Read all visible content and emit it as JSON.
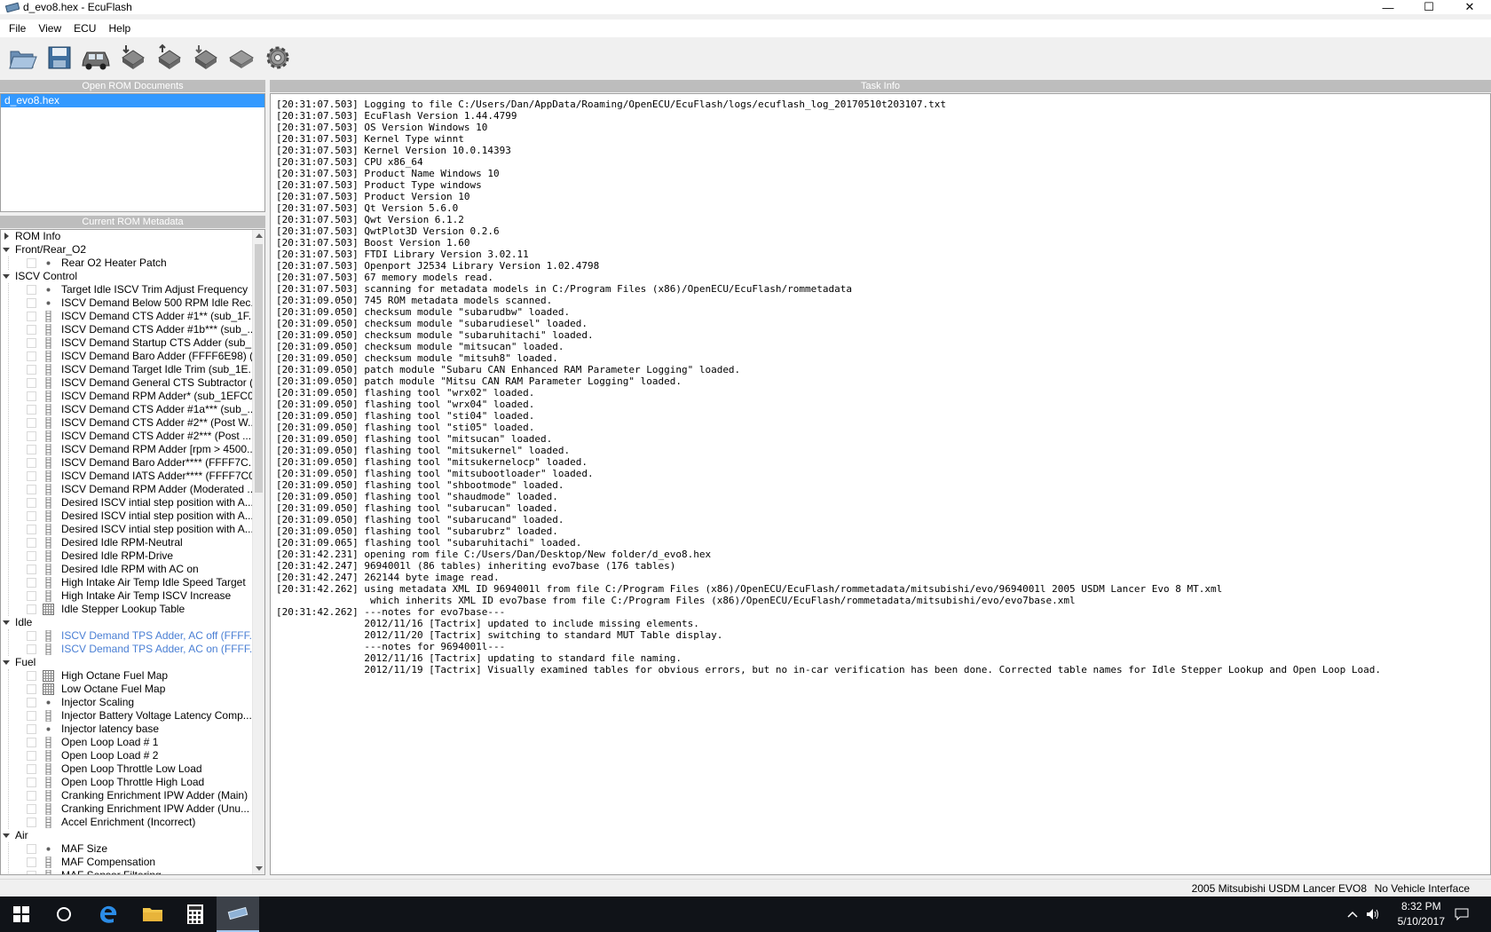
{
  "window": {
    "title": "d_evo8.hex - EcuFlash",
    "minimize": "—",
    "maximize": "☐",
    "close": "✕"
  },
  "menu": [
    "File",
    "View",
    "ECU",
    "Help"
  ],
  "toolbar": {
    "buttons": [
      "open-icon",
      "save-icon",
      "car-icon",
      "read-rom-icon",
      "write-rom-icon",
      "test-write-icon",
      "chip-icon",
      "settings-gear-icon"
    ]
  },
  "open_rom": {
    "header": "Open ROM Documents",
    "items": [
      "d_evo8.hex"
    ]
  },
  "metadata": {
    "header": "Current ROM Metadata",
    "categories": [
      {
        "label": "ROM Info",
        "expanded": false,
        "items": []
      },
      {
        "label": "Front/Rear_O2",
        "expanded": true,
        "items": [
          {
            "label": "Rear O2 Heater Patch",
            "icon": "scalar-icon"
          }
        ]
      },
      {
        "label": "ISCV Control",
        "expanded": true,
        "items": [
          {
            "label": "Target Idle ISCV Trim Adjust Frequency",
            "icon": "scalar-icon"
          },
          {
            "label": "ISCV Demand Below 500 RPM Idle Rec...",
            "icon": "scalar-icon"
          },
          {
            "label": "ISCV Demand CTS Adder #1** (sub_1F...",
            "icon": "axis-icon"
          },
          {
            "label": "ISCV Demand CTS Adder #1b*** (sub_...",
            "icon": "axis-icon"
          },
          {
            "label": "ISCV Demand Startup CTS Adder (sub_...",
            "icon": "axis-icon"
          },
          {
            "label": "ISCV Demand Baro Adder (FFFF6E98) (...",
            "icon": "axis-icon"
          },
          {
            "label": "ISCV Demand Target Idle Trim (sub_1E...",
            "icon": "axis-icon"
          },
          {
            "label": "ISCV Demand General CTS Subtractor (...",
            "icon": "axis-icon"
          },
          {
            "label": "ISCV Demand RPM Adder* (sub_1EFC0)",
            "icon": "axis-icon"
          },
          {
            "label": "ISCV Demand CTS Adder #1a*** (sub_...",
            "icon": "axis-icon"
          },
          {
            "label": "ISCV Demand CTS Adder #2** (Post W...",
            "icon": "axis-icon"
          },
          {
            "label": "ISCV Demand CTS Adder #2*** (Post ...",
            "icon": "axis-icon"
          },
          {
            "label": "ISCV Demand RPM Adder [rpm > 4500...",
            "icon": "axis-icon"
          },
          {
            "label": "ISCV Demand Baro Adder**** (FFFF7C...",
            "icon": "axis-icon"
          },
          {
            "label": "ISCV Demand IATS Adder**** (FFFF7C0...",
            "icon": "axis-icon"
          },
          {
            "label": "ISCV Demand RPM Adder (Moderated ...",
            "icon": "axis-icon"
          },
          {
            "label": "Desired ISCV intial step position with A...",
            "icon": "axis-icon"
          },
          {
            "label": "Desired ISCV intial step position with A...",
            "icon": "axis-icon"
          },
          {
            "label": "Desired ISCV intial step position with A...",
            "icon": "axis-icon"
          },
          {
            "label": "Desired Idle RPM-Neutral",
            "icon": "axis-icon"
          },
          {
            "label": "Desired Idle RPM-Drive",
            "icon": "axis-icon"
          },
          {
            "label": "Desired Idle RPM with AC on",
            "icon": "axis-icon"
          },
          {
            "label": "High Intake Air Temp Idle Speed Target",
            "icon": "axis-icon"
          },
          {
            "label": "High Intake Air Temp ISCV Increase",
            "icon": "axis-icon"
          },
          {
            "label": "Idle Stepper Lookup Table",
            "icon": "table-icon"
          }
        ]
      },
      {
        "label": "Idle",
        "expanded": true,
        "items": [
          {
            "label": "ISCV Demand TPS Adder, AC off (FFFF...",
            "icon": "axis-icon",
            "disabled": true
          },
          {
            "label": "ISCV Demand TPS Adder, AC on (FFFF...",
            "icon": "axis-icon",
            "disabled": true
          }
        ]
      },
      {
        "label": "Fuel",
        "expanded": true,
        "items": [
          {
            "label": "High Octane Fuel Map",
            "icon": "table-icon"
          },
          {
            "label": "Low Octane Fuel Map",
            "icon": "table-icon"
          },
          {
            "label": "Injector Scaling",
            "icon": "scalar-icon"
          },
          {
            "label": "Injector Battery Voltage Latency Comp...",
            "icon": "axis-icon"
          },
          {
            "label": "Injector latency base",
            "icon": "scalar-icon"
          },
          {
            "label": "Open Loop Load # 1",
            "icon": "axis-icon"
          },
          {
            "label": "Open Loop Load # 2",
            "icon": "axis-icon"
          },
          {
            "label": "Open Loop Throttle Low Load",
            "icon": "axis-icon"
          },
          {
            "label": "Open Loop Throttle High Load",
            "icon": "axis-icon"
          },
          {
            "label": "Cranking Enrichment IPW Adder (Main)",
            "icon": "axis-icon"
          },
          {
            "label": "Cranking Enrichment IPW Adder (Unu...",
            "icon": "axis-icon"
          },
          {
            "label": "Accel Enrichment (Incorrect)",
            "icon": "axis-icon"
          }
        ]
      },
      {
        "label": "Air",
        "expanded": true,
        "items": [
          {
            "label": "MAF Size",
            "icon": "scalar-icon"
          },
          {
            "label": "MAF Compensation",
            "icon": "axis-icon"
          },
          {
            "label": "MAF Sensor Filtering",
            "icon": "axis-icon"
          }
        ]
      }
    ]
  },
  "task_info": {
    "header": "Task Info",
    "lines": [
      "[20:31:07.503] Logging to file C:/Users/Dan/AppData/Roaming/OpenECU/EcuFlash/logs/ecuflash_log_20170510t203107.txt",
      "[20:31:07.503] EcuFlash Version 1.44.4799",
      "[20:31:07.503] OS Version Windows 10",
      "[20:31:07.503] Kernel Type winnt",
      "[20:31:07.503] Kernel Version 10.0.14393",
      "[20:31:07.503] CPU x86_64",
      "[20:31:07.503] Product Name Windows 10",
      "[20:31:07.503] Product Type windows",
      "[20:31:07.503] Product Version 10",
      "[20:31:07.503] Qt Version 5.6.0",
      "[20:31:07.503] Qwt Version 6.1.2",
      "[20:31:07.503] QwtPlot3D Version 0.2.6",
      "[20:31:07.503] Boost Version 1.60",
      "[20:31:07.503] FTDI Library Version 3.02.11",
      "[20:31:07.503] Openport J2534 Library Version 1.02.4798",
      "[20:31:07.503] 67 memory models read.",
      "[20:31:07.503] scanning for metadata models in C:/Program Files (x86)/OpenECU/EcuFlash/rommetadata",
      "[20:31:09.050] 745 ROM metadata models scanned.",
      "[20:31:09.050] checksum module \"subarudbw\" loaded.",
      "[20:31:09.050] checksum module \"subarudiesel\" loaded.",
      "[20:31:09.050] checksum module \"subaruhitachi\" loaded.",
      "[20:31:09.050] checksum module \"mitsucan\" loaded.",
      "[20:31:09.050] checksum module \"mitsuh8\" loaded.",
      "[20:31:09.050] patch module \"Subaru CAN Enhanced RAM Parameter Logging\" loaded.",
      "[20:31:09.050] patch module \"Mitsu CAN RAM Parameter Logging\" loaded.",
      "[20:31:09.050] flashing tool \"wrx02\" loaded.",
      "[20:31:09.050] flashing tool \"wrx04\" loaded.",
      "[20:31:09.050] flashing tool \"sti04\" loaded.",
      "[20:31:09.050] flashing tool \"sti05\" loaded.",
      "[20:31:09.050] flashing tool \"mitsucan\" loaded.",
      "[20:31:09.050] flashing tool \"mitsukernel\" loaded.",
      "[20:31:09.050] flashing tool \"mitsukernelocp\" loaded.",
      "[20:31:09.050] flashing tool \"mitsubootloader\" loaded.",
      "[20:31:09.050] flashing tool \"shbootmode\" loaded.",
      "[20:31:09.050] flashing tool \"shaudmode\" loaded.",
      "[20:31:09.050] flashing tool \"subarucan\" loaded.",
      "[20:31:09.050] flashing tool \"subarucand\" loaded.",
      "[20:31:09.050] flashing tool \"subarubrz\" loaded.",
      "[20:31:09.065] flashing tool \"subaruhitachi\" loaded.",
      "[20:31:42.231] opening rom file C:/Users/Dan/Desktop/New folder/d_evo8.hex",
      "[20:31:42.247] 9694001l (86 tables) inheriting evo7base (176 tables)",
      "[20:31:42.247] 262144 byte image read.",
      "[20:31:42.262] using metadata XML ID 9694001l from file C:/Program Files (x86)/OpenECU/EcuFlash/rommetadata/mitsubishi/evo/9694001l 2005 USDM Lancer Evo 8 MT.xml",
      "                which inherits XML ID evo7base from file C:/Program Files (x86)/OpenECU/EcuFlash/rommetadata/mitsubishi/evo/evo7base.xml",
      "[20:31:42.262] ---notes for evo7base---",
      "               2012/11/16 [Tactrix] updated to include missing elements.",
      "               2012/11/20 [Tactrix] switching to standard MUT Table display.",
      "               ---notes for 9694001l---",
      "               2012/11/16 [Tactrix] updating to standard file naming.",
      "               2012/11/19 [Tactrix] Visually examined tables for obvious errors, but no in-car verification has been done. Corrected table names for Idle Stepper Lookup and Open Loop Load."
    ]
  },
  "status": {
    "vehicle": "2005 Mitsubishi USDM Lancer EVO8",
    "interface": "No Vehicle Interface"
  },
  "taskbar": {
    "time": "8:32 PM",
    "date": "5/10/2017"
  },
  "colors": {
    "selection": "#3399ff",
    "panel_header": "#bdbdbd",
    "disabled_text": "#4a7fd4",
    "taskbar": "#101318"
  }
}
